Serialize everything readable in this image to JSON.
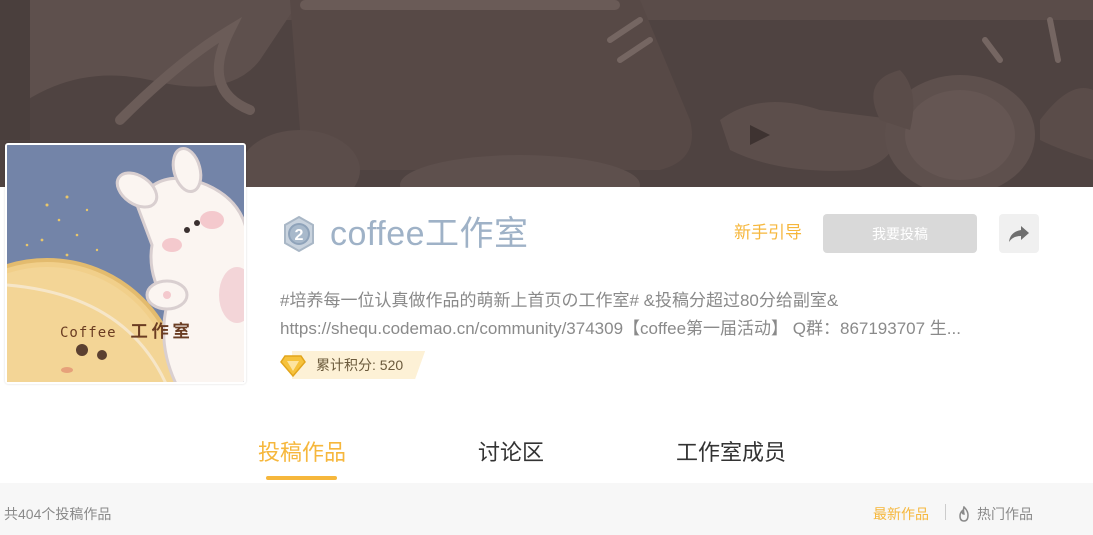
{
  "studio": {
    "name": "coffee工作室",
    "level": "2",
    "description_line1": "#培养每一位认真做作品的萌新上首页の工作室# &投稿分超过80分给副室&",
    "description_line2": "https://shequ.codemao.cn/community/374309【coffee第一届活动】 Q群：867193707 生...",
    "score_label": "累计积分: 520",
    "avatar_text_en": "Coffee",
    "avatar_text_cn": "工作室"
  },
  "actions": {
    "guide_label": "新手引导",
    "submit_label": "我要投稿"
  },
  "tabs": [
    {
      "label": "投稿作品",
      "active": true
    },
    {
      "label": "讨论区",
      "active": false
    },
    {
      "label": "工作室成员",
      "active": false
    }
  ],
  "works": {
    "count_label": "共404个投稿作品",
    "sort_new": "最新作品",
    "sort_hot": "热门作品"
  },
  "colors": {
    "accent": "#f6b73c",
    "banner": "#4f4341",
    "title": "#9fb2c7"
  },
  "icons": {
    "level": "level-badge-icon",
    "share": "share-icon",
    "diamond": "diamond-icon",
    "hot": "fire-icon"
  }
}
